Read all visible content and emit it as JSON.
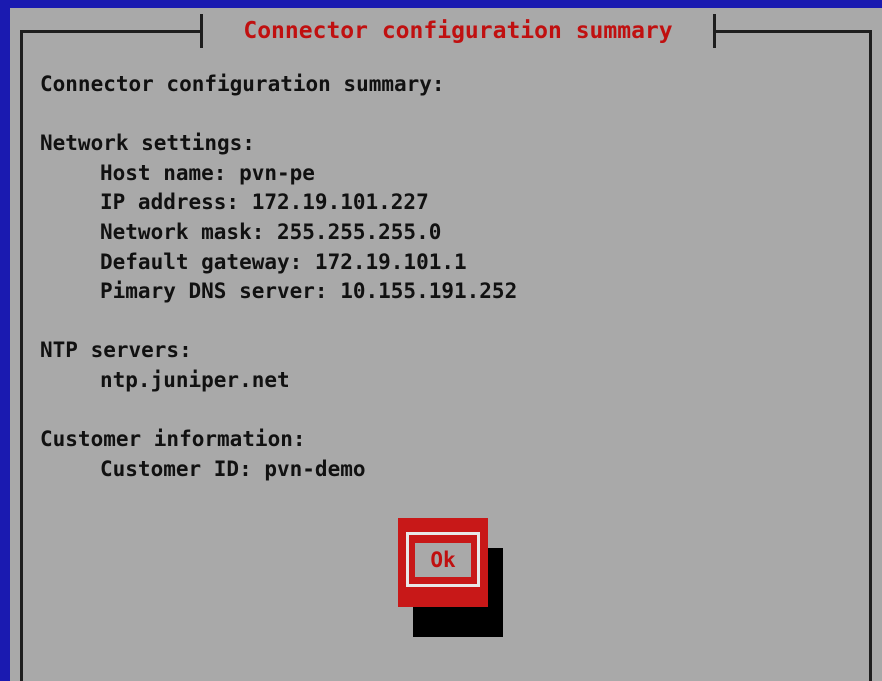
{
  "dialog": {
    "title": "Connector configuration summary",
    "heading": "Connector configuration summary:"
  },
  "network": {
    "section_label": "Network settings:",
    "host_name": "Host name: pvn-pe",
    "ip_address": "IP address: 172.19.101.227",
    "network_mask": "Network mask: 255.255.255.0",
    "default_gateway": "Default gateway: 172.19.101.1",
    "primary_dns": "Pimary DNS server: 10.155.191.252"
  },
  "ntp": {
    "section_label": "NTP servers:",
    "server": "ntp.juniper.net"
  },
  "customer": {
    "section_label": "Customer information:",
    "customer_id": "Customer ID: pvn-demo"
  },
  "actions": {
    "ok_label": "Ok"
  },
  "colors": {
    "background": "#a9a9a9",
    "title_text": "#c01010",
    "button_bg": "#c81818",
    "outer_border": "#1a1ab0"
  }
}
